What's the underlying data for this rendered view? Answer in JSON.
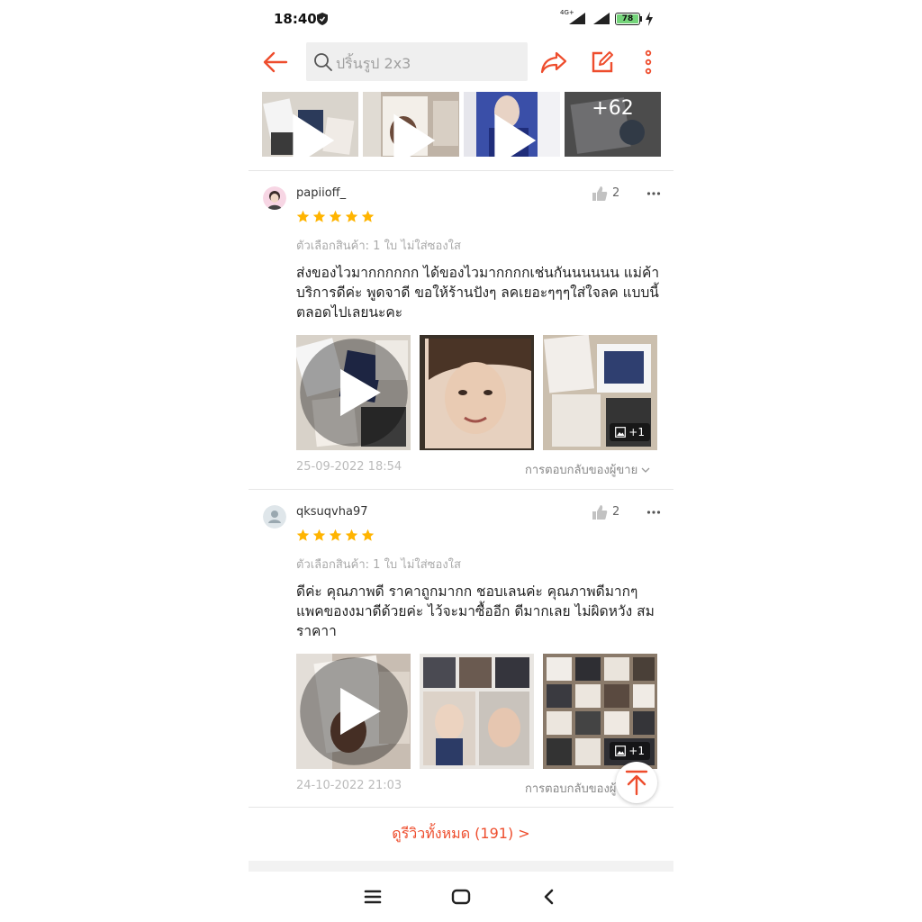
{
  "status_bar": {
    "time": "18:40",
    "network": "4G+",
    "battery": "78"
  },
  "header": {
    "search_placeholder": "ปริ้นรูป 2x3"
  },
  "top_thumbnails": {
    "more_count": "+62"
  },
  "reviews": [
    {
      "username": "papiioff_",
      "likes": "2",
      "rating": 5,
      "variation": "ตัวเลือกสินค้า: 1 ใบ ไม่ใส่ซองใส",
      "text": "ส่งของไวมากกกกกก ได้ของไวมากกกกเช่นกันนนนนน แม่ค้าบริการดีค่ะ พูดจาดี ขอให้ร้านปังๆ ลคเยอะๆๆๆใส่ใจลค แบบนี้ตลอดไปเลยนะคะ",
      "extra_media": "+1",
      "date": "25-09-2022 18:54",
      "seller_reply": "การตอบกลับของผู้ขาย"
    },
    {
      "username": "qksuqvha97",
      "likes": "2",
      "rating": 5,
      "variation": "ตัวเลือกสินค้า: 1 ใบ ไม่ใส่ซองใส",
      "text": "ดีค่ะ คุณภาพดี ราคาถูกมากก ชอบเลนค่ะ คุณภาพดีมากๆ แพคของงมาดีด้วยค่ะ ไว้จะมาซื้ออีก ดีมากเลย ไม่ผิดหวัง สมราคาา",
      "extra_media": "+1",
      "date": "24-10-2022 21:03",
      "seller_reply": "การตอบกลับของผู้ขาย"
    }
  ],
  "see_all": "ดูรีวิวทั้งหมด (191) >",
  "colors": {
    "accent": "#ee4d2d",
    "star": "#ffb400"
  },
  "icons": [
    "shield-icon",
    "signal-icon",
    "battery-icon",
    "bolt-icon",
    "back-arrow-icon",
    "search-icon",
    "share-icon",
    "edit-icon",
    "more-vert-icon",
    "play-icon",
    "like-icon",
    "more-horiz-icon",
    "star-icon",
    "image-icon",
    "chevron-down-icon",
    "scroll-top-icon",
    "menu-icon",
    "home-icon",
    "back-nav-icon"
  ]
}
